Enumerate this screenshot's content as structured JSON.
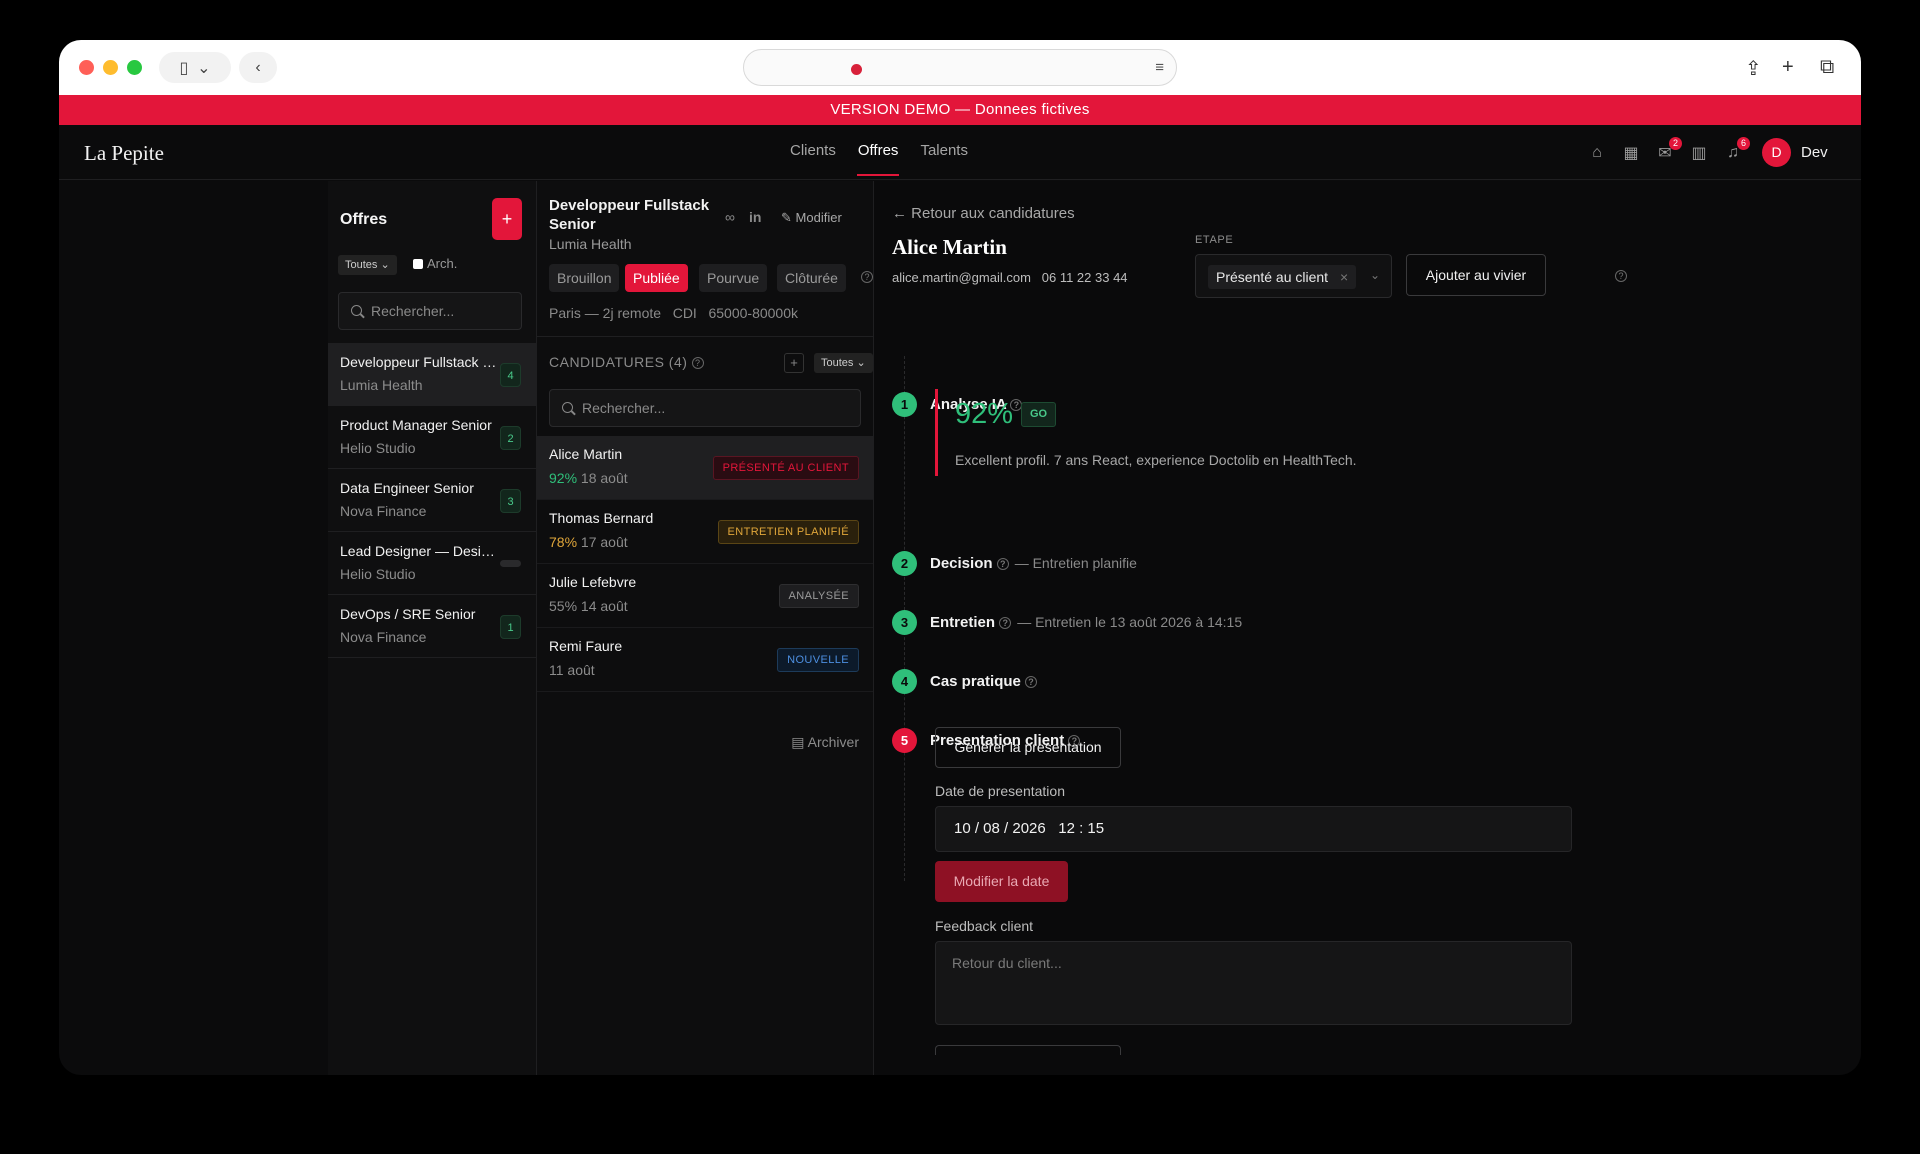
{
  "browser": {
    "tab_toggle_icon": "sidebar-icon"
  },
  "banner": {
    "text": "VERSION DEMO — Donnees fictives"
  },
  "header": {
    "logo": "La Pepite",
    "tabs": [
      {
        "label": "Clients",
        "active": false
      },
      {
        "label": "Offres",
        "active": true
      },
      {
        "label": "Talents",
        "active": false
      }
    ],
    "mail_badge": "2",
    "notif_badge": "6",
    "avatar_initial": "D",
    "user_name": "Dev"
  },
  "offers_panel": {
    "title": "Offres",
    "add_label": "+",
    "filter": "Toutes",
    "archived_label": "Arch.",
    "search_placeholder": "Rechercher...",
    "items": [
      {
        "title": "Developpeur Fullstack Senior",
        "company": "Lumia Health",
        "count": "4",
        "active": true
      },
      {
        "title": "Product Manager Senior",
        "company": "Helio Studio",
        "count": "2",
        "active": false
      },
      {
        "title": "Data Engineer Senior",
        "company": "Nova Finance",
        "count": "3",
        "active": false
      },
      {
        "title": "Lead Designer — Design System",
        "company": "Helio Studio",
        "count": "",
        "active": false
      },
      {
        "title": "DevOps / SRE Senior",
        "company": "Nova Finance",
        "count": "1",
        "active": false
      }
    ]
  },
  "job": {
    "title": "Developpeur Fullstack Senior",
    "company": "Lumia Health",
    "edit_label": "Modifier",
    "statuses": [
      {
        "label": "Brouillon",
        "active": false
      },
      {
        "label": "Publiée",
        "active": true
      },
      {
        "label": "Pourvue",
        "active": false
      },
      {
        "label": "Clôturée",
        "active": false
      }
    ],
    "meta": "Paris — 2j remote   CDI   65000-80000k",
    "candidates_heading": "CANDIDATURES (4)",
    "candidates_filter": "Toutes",
    "search_placeholder": "Rechercher...",
    "candidates": [
      {
        "name": "Alice Martin",
        "score": "92%",
        "date": "18 août",
        "status": "PRÉSENTÉ AU CLIENT",
        "active": true
      },
      {
        "name": "Thomas Bernard",
        "score": "78%",
        "date": "17 août",
        "status": "ENTRETIEN PLANIFIÉ",
        "active": false
      },
      {
        "name": "Julie Lefebvre",
        "score": "55%",
        "date": "14 août",
        "status": "ANALYSÉE",
        "active": false
      },
      {
        "name": "Remi Faure",
        "score": "",
        "date": "11 août",
        "status": "NOUVELLE",
        "active": false
      }
    ],
    "archive_label": "Archiver"
  },
  "candidate": {
    "back_label": "Retour aux candidatures",
    "name": "Alice Martin",
    "email": "alice.martin@gmail.com",
    "phone": "06 11 22 33 44",
    "etape_label": "ETAPE",
    "etape_value": "Présenté au client",
    "vivier_label": "Ajouter au vivier",
    "steps": [
      {
        "n": "1",
        "title": "Analyse IA",
        "sub": ""
      },
      {
        "n": "2",
        "title": "Decision",
        "sub": "— Entretien planifie"
      },
      {
        "n": "3",
        "title": "Entretien",
        "sub": "— Entretien le 13 août 2026 à 14:15"
      },
      {
        "n": "4",
        "title": "Cas pratique",
        "sub": ""
      },
      {
        "n": "5",
        "title": "Presentation client",
        "sub": ""
      }
    ],
    "ia_score": "92%",
    "ia_verdict": "GO",
    "ia_summary": "Excellent profil. 7 ans React, experience Doctolib en HealthTech.",
    "generate_label": "Generer la presentation",
    "date_label": "Date de presentation",
    "date_value": "10 / 08 / 2026   12 : 15",
    "modify_date_label": "Modifier la date",
    "feedback_label": "Feedback client",
    "feedback_placeholder": "Retour du client..."
  },
  "colors": {
    "accent": "#e3163a",
    "success": "#2fbf7a",
    "warning": "#e0a63a",
    "info": "#4d8fe0"
  }
}
